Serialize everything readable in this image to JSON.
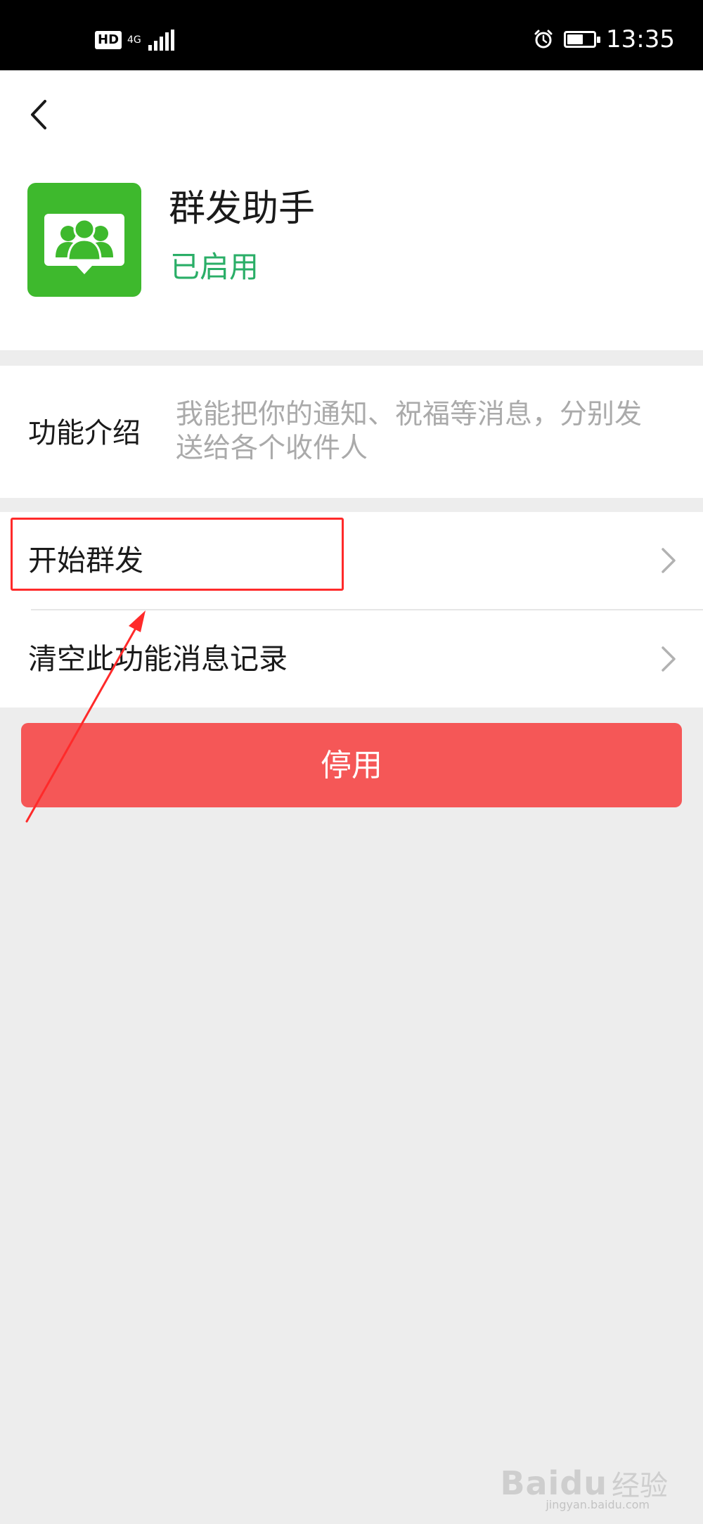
{
  "status_bar": {
    "hd_badge": "HD",
    "network": "4G",
    "time": "13:35"
  },
  "header": {
    "app_name": "群发助手",
    "app_status": "已启用",
    "accent_color": "#3eb92d",
    "status_color": "#2aae67"
  },
  "intro": {
    "label": "功能介绍",
    "description": "我能把你的通知、祝福等消息，分别发送给各个收件人"
  },
  "menu": {
    "items": [
      {
        "label": "开始群发"
      },
      {
        "label": "清空此功能消息记录"
      }
    ]
  },
  "actions": {
    "disable_label": "停用",
    "disable_color": "#f55757"
  },
  "watermark": {
    "brand": "Baidu",
    "suffix": "经验",
    "url": "jingyan.baidu.com"
  }
}
